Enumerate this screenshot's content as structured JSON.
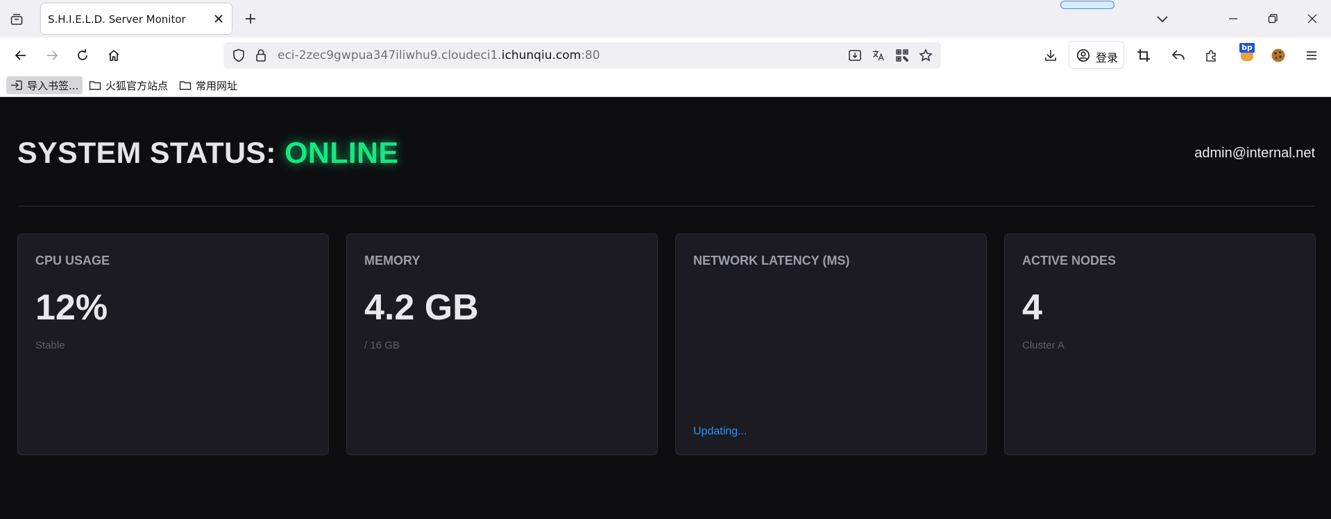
{
  "browser": {
    "tab_title": "S.H.I.E.L.D. Server Monitor",
    "url_prefix": "eci-2zec9gwpua347iliwhu9.cloudeci1.",
    "url_domain": "ichunqiu.com",
    "url_suffix": ":80",
    "login_label": "登录",
    "bp_badge": "bp",
    "bookmarks": [
      "导入书签...",
      "火狐官方站点",
      "常用网址"
    ]
  },
  "page": {
    "status_label": "SYSTEM STATUS: ",
    "status_value": "ONLINE",
    "status_color": "#14e882",
    "user": "admin@internal.net",
    "cards": [
      {
        "title": "CPU USAGE",
        "value": "12%",
        "sub": "Stable",
        "note": ""
      },
      {
        "title": "MEMORY",
        "value": "4.2 GB",
        "sub": "/ 16 GB",
        "note": ""
      },
      {
        "title": "NETWORK LATENCY (MS)",
        "value": "",
        "sub": "",
        "note": "Updating..."
      },
      {
        "title": "ACTIVE NODES",
        "value": "4",
        "sub": "Cluster A",
        "note": ""
      }
    ]
  },
  "icons": [
    "tab-list-icon",
    "close-icon",
    "plus-icon",
    "chevron-down-icon",
    "minimize-icon",
    "restore-icon",
    "window-close-icon",
    "back-icon",
    "forward-icon",
    "reload-icon",
    "home-icon",
    "shield-icon",
    "lock-icon",
    "save-page-icon",
    "translate-icon",
    "qr-code-icon",
    "star-icon",
    "download-icon",
    "account-icon",
    "screenshot-icon",
    "undo-icon",
    "extensions-icon",
    "burp-extension-icon",
    "cookie-icon",
    "menu-icon",
    "import-icon",
    "folder-icon"
  ]
}
